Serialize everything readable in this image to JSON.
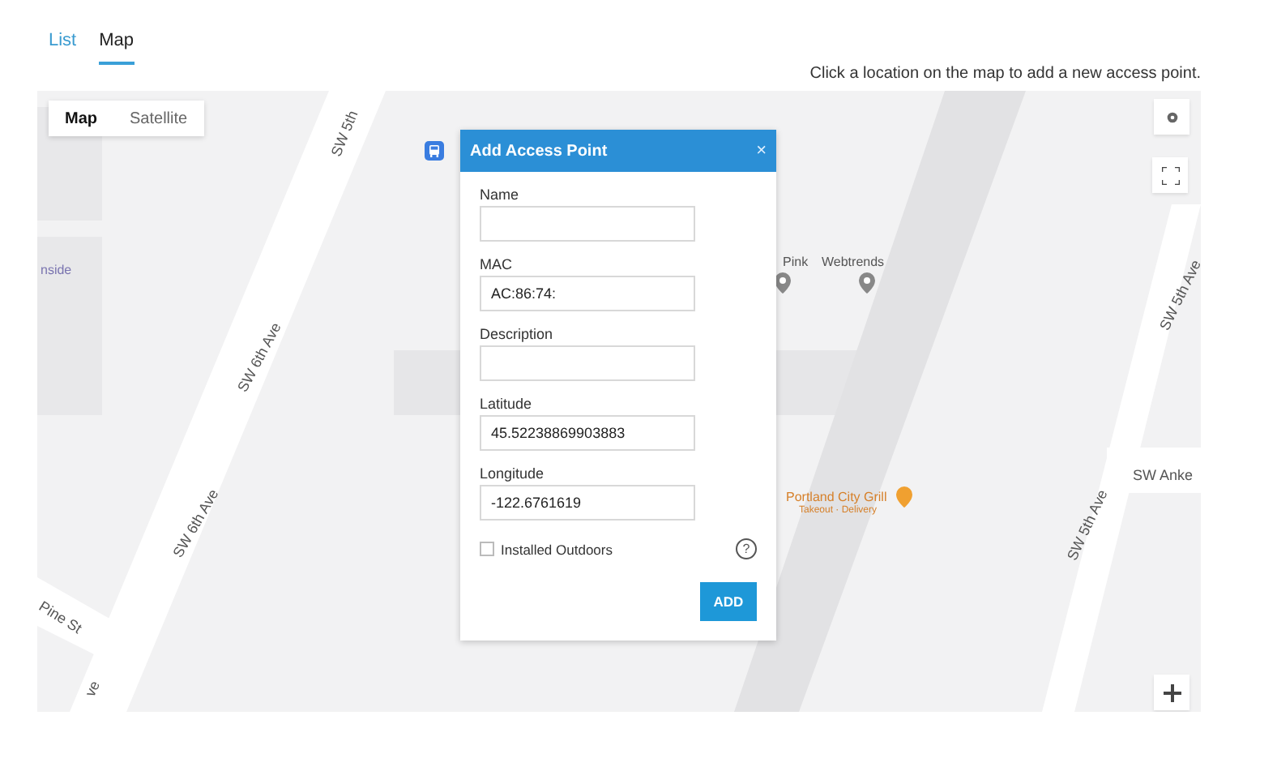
{
  "tabs": [
    {
      "label": "List",
      "selected": false
    },
    {
      "label": "Map",
      "selected": true
    }
  ],
  "hint": "Click a location on the map to add a new access point.",
  "map": {
    "type_control": [
      {
        "label": "Map",
        "selected": true
      },
      {
        "label": "Satellite",
        "selected": false
      }
    ],
    "labels": [
      {
        "text": "SW 5th",
        "kind": "street"
      },
      {
        "text": "nside",
        "kind": "place"
      },
      {
        "text": "SW 6th Ave",
        "kind": "street"
      },
      {
        "text": "SW 6th Ave",
        "kind": "street"
      },
      {
        "text": "Pine St",
        "kind": "street"
      },
      {
        "text": "ve",
        "kind": "street"
      },
      {
        "text": "Pink",
        "kind": "poi"
      },
      {
        "text": "Webtrends",
        "kind": "poi"
      },
      {
        "text": "SW 5th Ave",
        "kind": "street"
      },
      {
        "text": "SW Anke",
        "kind": "street"
      },
      {
        "text": "SW 5th Ave",
        "kind": "street"
      },
      {
        "text": "Portland City Grill",
        "kind": "restaurant"
      },
      {
        "text": "Takeout · Delivery",
        "kind": "restaurant-sub"
      }
    ]
  },
  "dialog": {
    "title": "Add Access Point",
    "close": "×",
    "fields": [
      {
        "label": "Name"
      },
      {
        "label": "MAC",
        "value": "AC:86:74:"
      },
      {
        "label": "Description"
      },
      {
        "label": "Latitude",
        "value": "45.52238869903883"
      },
      {
        "label": "Longitude",
        "value": "-122.6761619"
      }
    ],
    "outdoors": {
      "label": "Installed Outdoors",
      "checked": false
    },
    "help": "?",
    "button": "ADD"
  }
}
